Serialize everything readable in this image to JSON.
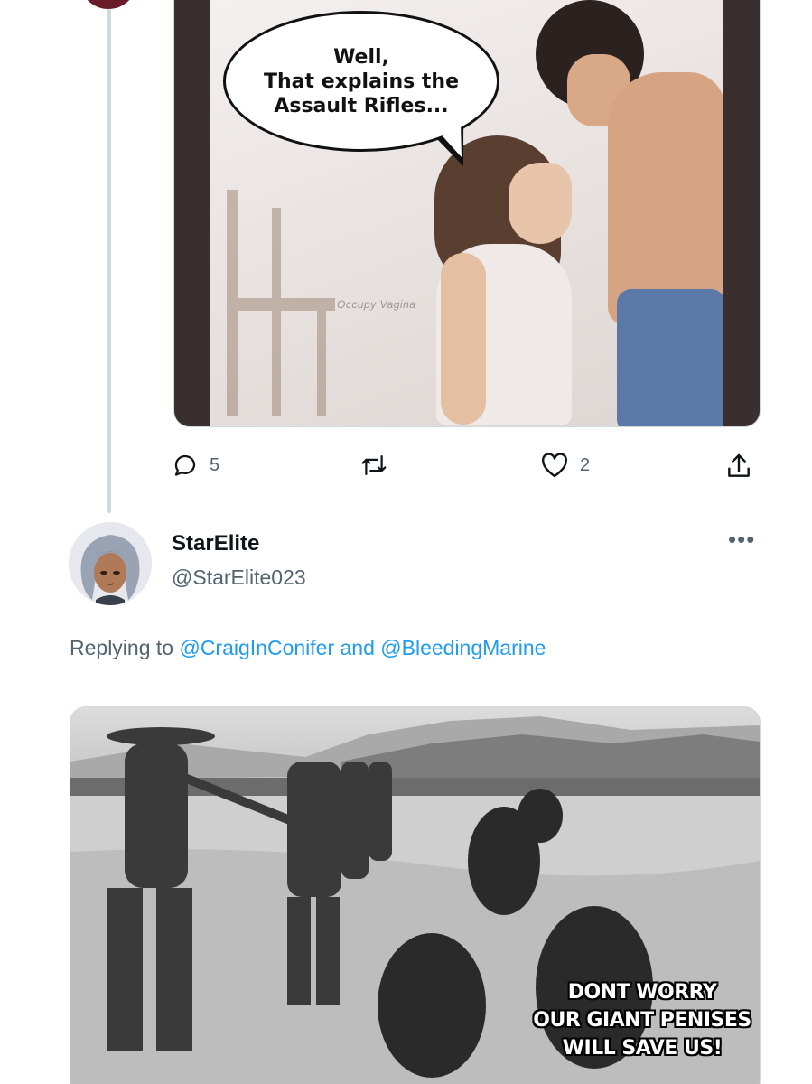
{
  "first_tweet": {
    "media": {
      "speech_bubble_lines": [
        "Well,",
        "That explains the",
        "Assault Rifles..."
      ],
      "watermark": "Occupy Vagina"
    },
    "actions": {
      "reply_count": "5",
      "retweet_count": "",
      "like_count": "2"
    }
  },
  "second_tweet": {
    "display_name": "StarElite",
    "handle": "@StarElite023",
    "more_label": "•••",
    "replying_prefix": "Replying to",
    "replying_mention_1": "@CraigInConifer",
    "replying_and": "and",
    "replying_mention_2": "@BleedingMarine",
    "media": {
      "caption_lines": [
        "DONT WORRY",
        "OUR GIANT PENISES",
        "WILL SAVE US!"
      ]
    }
  },
  "colors": {
    "text_primary": "#0f1419",
    "text_secondary": "#536471",
    "link": "#1d9bf0",
    "border": "#cfd9de"
  },
  "icons": {
    "reply": "reply-icon",
    "retweet": "retweet-icon",
    "like": "heart-icon",
    "share": "share-icon",
    "more": "more-icon"
  }
}
